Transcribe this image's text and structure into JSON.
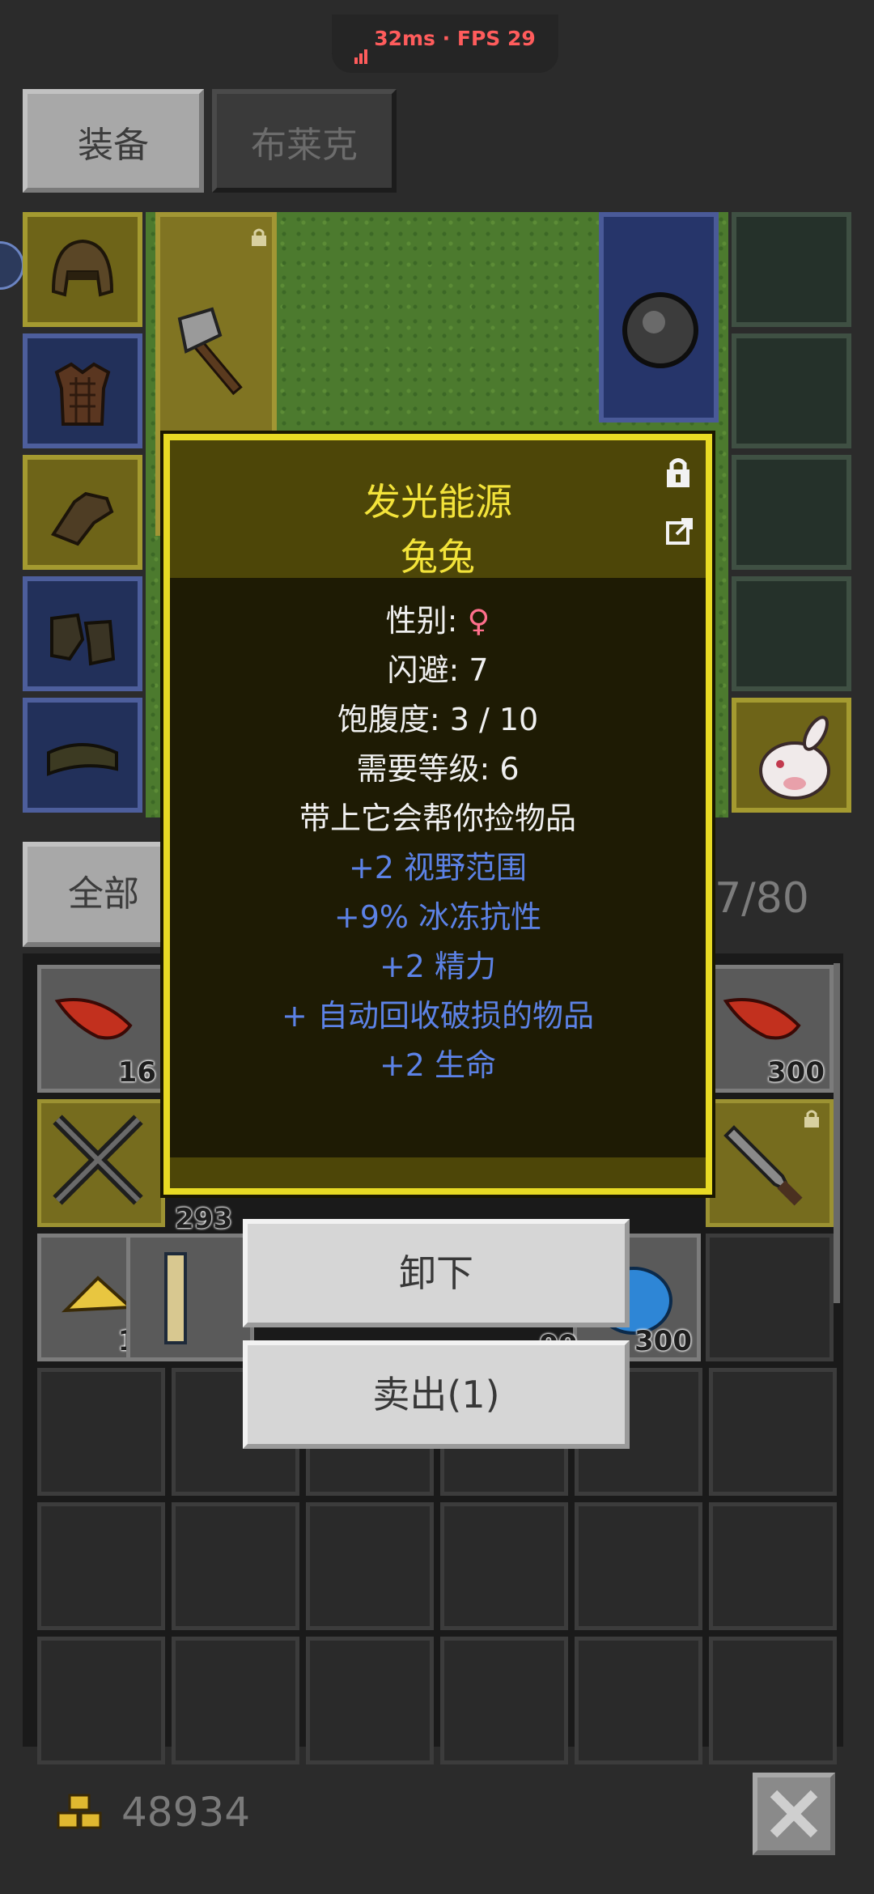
{
  "status": {
    "ping": "32ms",
    "separator": "·",
    "fps": "FPS 29"
  },
  "tabs": {
    "equip": "装备",
    "blake": "布莱克"
  },
  "tooltip": {
    "title": "发光能源",
    "subtitle": "兔兔",
    "gender_label": "性别: ",
    "gender_value": "♀",
    "lines_white": [
      "闪避: 7",
      "饱腹度: 3 / 10",
      "需要等级: 6",
      "带上它会帮你捡物品"
    ],
    "lines_blue": [
      "+2 视野范围",
      "+9% 冰冻抗性",
      "+2 精力",
      "+ 自动回收破损的物品",
      "+2 生命"
    ]
  },
  "buttons": {
    "unequip": "卸下",
    "sell": "卖出(1)"
  },
  "bag": {
    "tab_all": "全部",
    "capacity": "17/80",
    "counts": [
      "16",
      "300",
      "293",
      "12",
      "99",
      "300"
    ]
  },
  "gold": "48934",
  "colors": {
    "tooltip_border": "#e8da24",
    "title": "#f3e33a",
    "bonus": "#5c82e6",
    "female": "#ff6f8c"
  }
}
